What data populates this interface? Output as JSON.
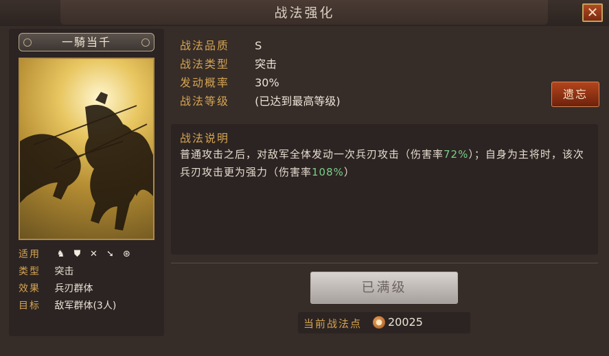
{
  "window": {
    "title": "战法强化",
    "close_label": "✕"
  },
  "card": {
    "name": "一騎当千",
    "stats": [
      {
        "label": "适用",
        "value": ""
      },
      {
        "label": "类型",
        "value": "突击"
      },
      {
        "label": "效果",
        "value": "兵刃群体"
      },
      {
        "label": "目标",
        "value": "敌军群体(3人)"
      }
    ],
    "troop_icons": [
      "cavalry-icon",
      "shield-icon",
      "bow-icon",
      "spear-icon",
      "wheel-icon"
    ]
  },
  "info": {
    "quality_label": "战法品质",
    "quality_value": "S",
    "type_label": "战法类型",
    "type_value": "突击",
    "rate_label": "发动概率",
    "rate_value": "30%",
    "level_label": "战法等级",
    "level_value": "(已达到最高等级)"
  },
  "forget_button": "遗忘",
  "description": {
    "title": "战法说明",
    "part1": "普通攻击之后，对敌军全体发动一次兵刃攻击（伤害率",
    "rate1": "72%",
    "part2": "）；自身为主将时，该次兵刃攻击更为强力（伤害率",
    "rate2": "108%",
    "part3": "）"
  },
  "maxed_button": "已满级",
  "points": {
    "label": "当前战法点",
    "value": "20025",
    "icon": "coin-icon"
  },
  "colors": {
    "accent_gold": "#d4a452",
    "highlight_green": "#7bd08a",
    "forget_red": "#b2451d"
  }
}
